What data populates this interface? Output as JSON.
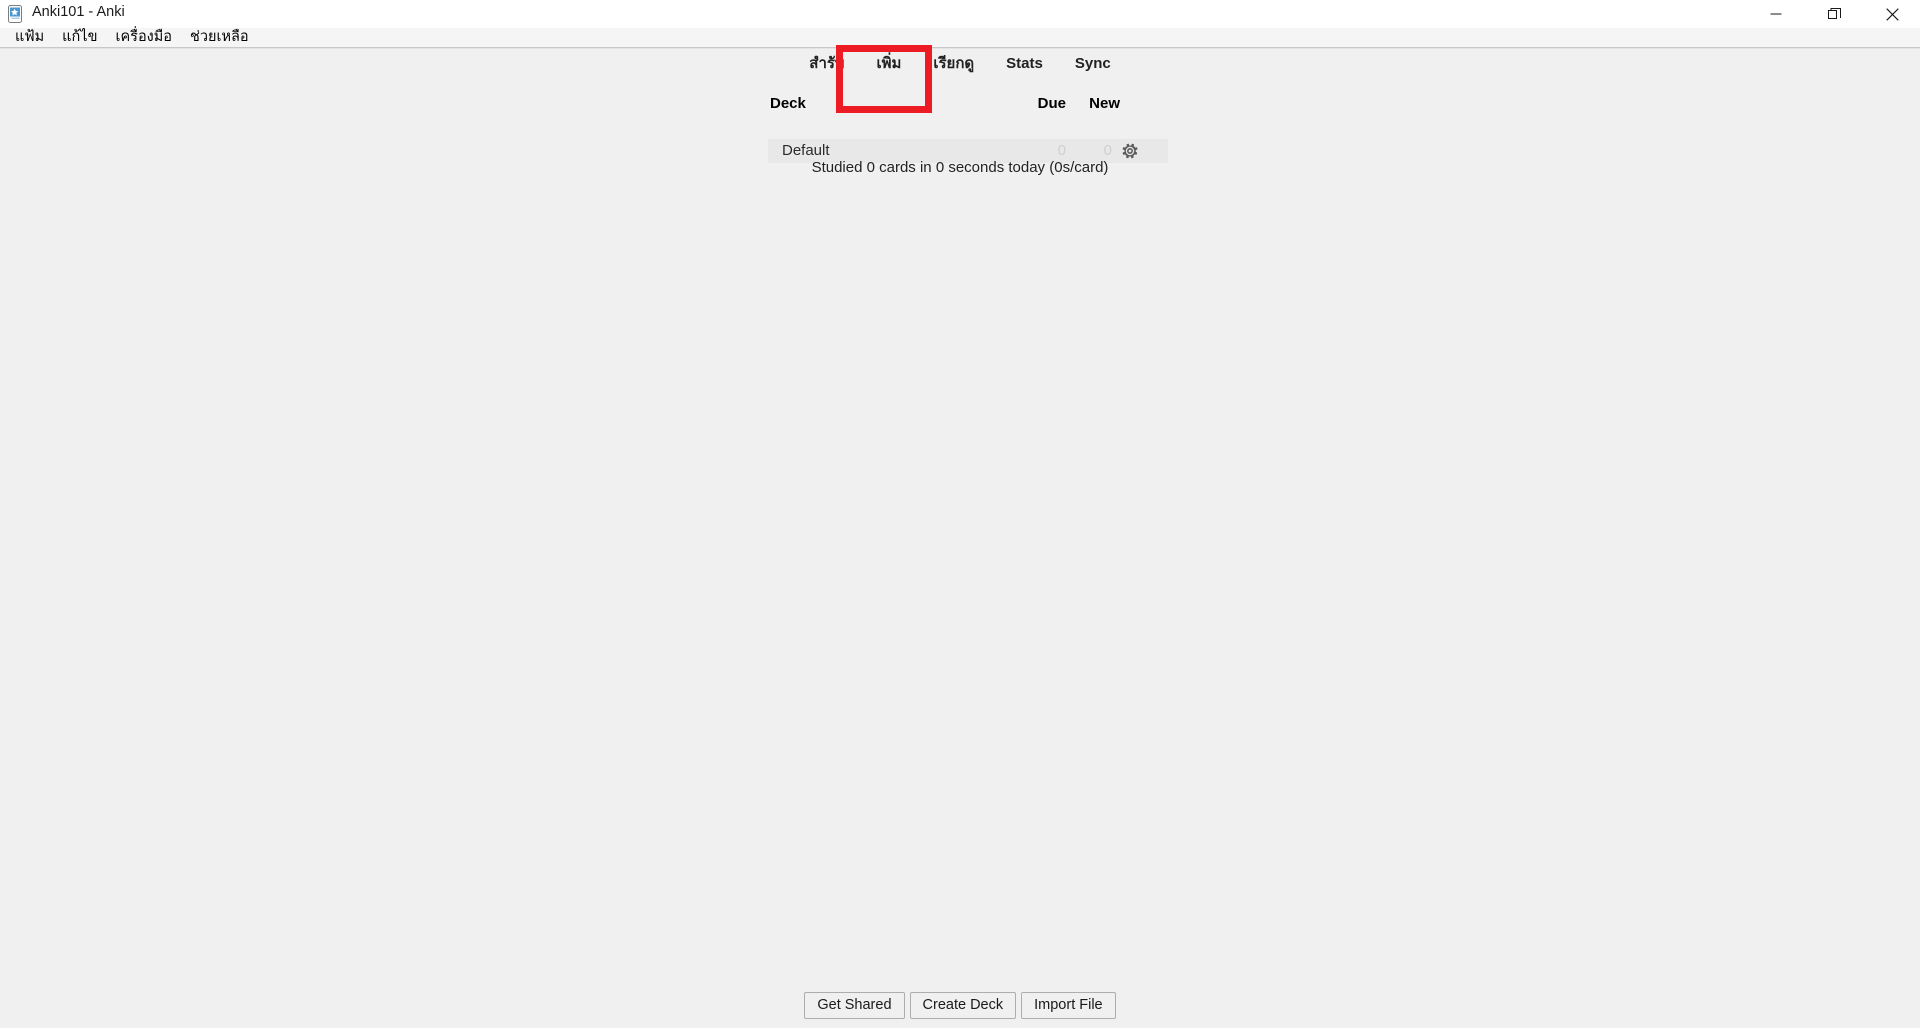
{
  "window": {
    "title": "Anki101 - Anki",
    "app_icon": "anki-card-icon",
    "controls": {
      "minimize": "minimize-icon",
      "restore": "restore-icon",
      "close": "close-icon"
    }
  },
  "menubar": {
    "items": [
      {
        "label": "แฟ้ม",
        "name": "file"
      },
      {
        "label": "แก้ไข",
        "name": "edit"
      },
      {
        "label": "เครื่องมือ",
        "name": "tools"
      },
      {
        "label": "ช่วยเหลือ",
        "name": "help"
      }
    ]
  },
  "toolbar": {
    "items": [
      {
        "label": "สำรับ",
        "name": "decks"
      },
      {
        "label": "เพิ่ม",
        "name": "add"
      },
      {
        "label": "เรียกดู",
        "name": "browse"
      },
      {
        "label": "Stats",
        "name": "stats"
      },
      {
        "label": "Sync",
        "name": "sync"
      }
    ],
    "highlighted_item": "เพิ่ม"
  },
  "annotation": {
    "type": "highlight-box",
    "color": "#ec1b24",
    "target": "เพิ่ม"
  },
  "deck_table": {
    "headers": {
      "deck": "Deck",
      "due": "Due",
      "new": "New"
    },
    "rows": [
      {
        "name": "Default",
        "due": "0",
        "new": "0",
        "gear": "gear-icon"
      }
    ]
  },
  "status": {
    "studied_text": "Studied 0 cards in 0 seconds today (0s/card)"
  },
  "bottom_buttons": [
    {
      "label": "Get Shared",
      "name": "get-shared"
    },
    {
      "label": "Create Deck",
      "name": "create-deck"
    },
    {
      "label": "Import File",
      "name": "import-file"
    }
  ],
  "colors": {
    "window_bg": "#f0f0f0",
    "titlebar_bg": "#ffffff",
    "row_bg": "#e8e8e8",
    "accent_red": "#ec1b24",
    "muted_text": "#cfcfcf"
  }
}
